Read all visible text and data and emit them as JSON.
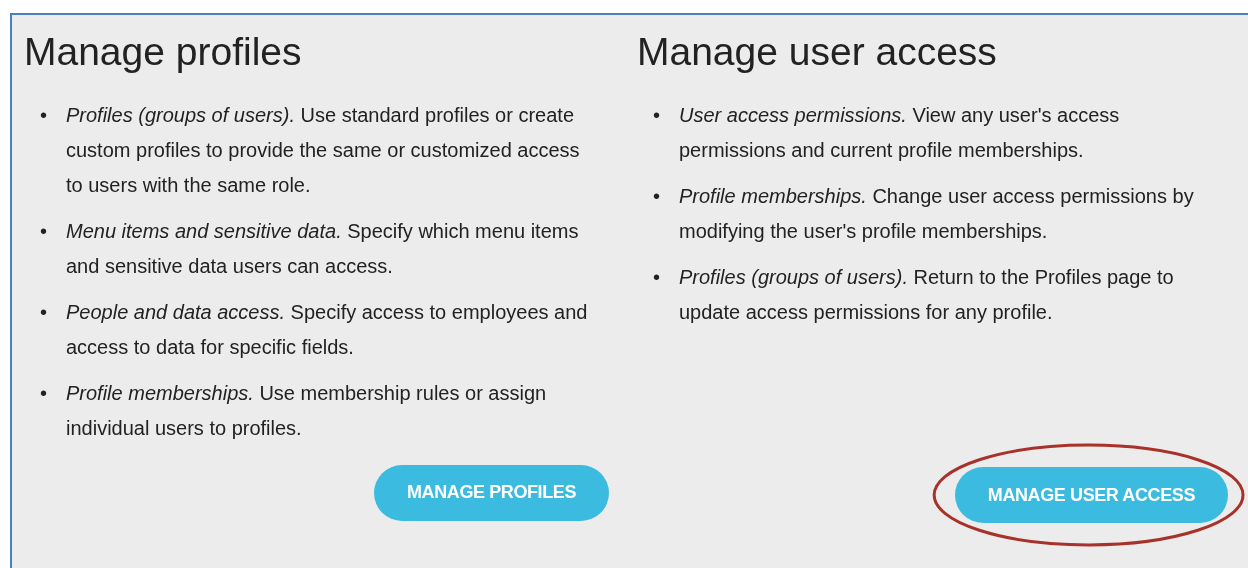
{
  "panels": [
    {
      "title": "Manage profiles",
      "bullets": [
        {
          "marker": "•",
          "text": "*Profiles (groups of users).* Use standard profiles or create custom profiles to provide the same or customized access to users with the same role."
        },
        {
          "marker": "•",
          "text": "*Menu items and sensitive data.* Specify which menu items and sensitive data users can access."
        },
        {
          "marker": "•",
          "text": "*People and data access.* Specify access to employees and access to data for specific fields."
        },
        {
          "marker": "•",
          "text": "*Profile memberships.* Use membership rules or assign individual users to profiles."
        }
      ],
      "button": {
        "label": "MANAGE PROFILES",
        "circled": false
      }
    },
    {
      "title": "Manage user access",
      "bullets": [
        {
          "marker": "•",
          "text": "*User access permissions.* View any user's access permissions and current profile memberships."
        },
        {
          "marker": "•",
          "text": "*Profile memberships.* Change user access permissions by modifying the user's profile memberships."
        },
        {
          "marker": "•",
          "text": "*Profiles (groups of users).* Return to the Profiles page to update access permissions for any profile."
        }
      ],
      "button": {
        "label": "MANAGE USER ACCESS",
        "circled": true
      }
    }
  ]
}
